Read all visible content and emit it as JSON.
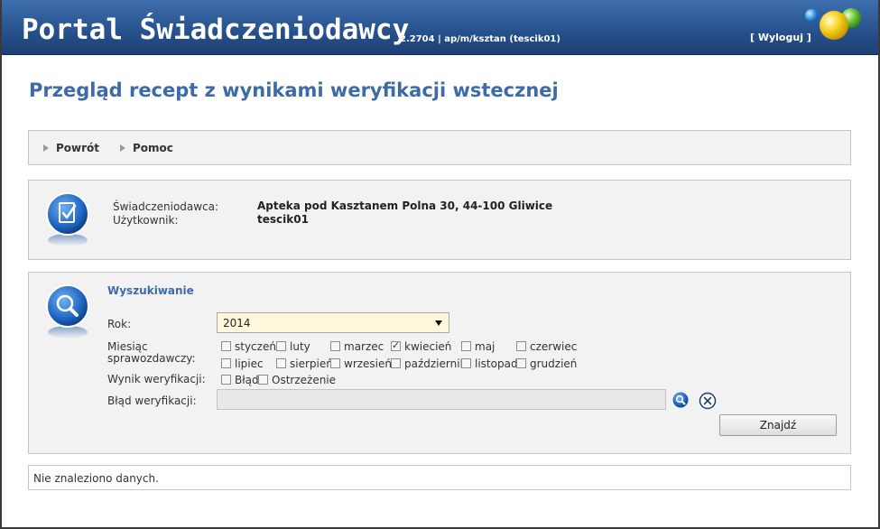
{
  "header": {
    "app_title": "Portal Świadczeniodawcy",
    "version": "2.2704 | ap/m/ksztan (tescik01)",
    "logout": "[ Wyloguj ]"
  },
  "page_title": "Przegląd recept z wynikami weryfikacji wstecznej",
  "nav": {
    "back": "Powrót",
    "help": "Pomoc"
  },
  "info": {
    "provider_label": "Świadczeniodawca:",
    "provider_value": "Apteka pod Kasztanem Polna 30, 44-100 Gliwice",
    "user_label": "Użytkownik:",
    "user_value": "tescik01"
  },
  "search": {
    "title": "Wyszukiwanie",
    "year_label": "Rok:",
    "year_value": "2014",
    "month_label_line1": "Miesiąc",
    "month_label_line2": "sprawozdawczy:",
    "months": [
      {
        "label": "styczeń",
        "checked": false
      },
      {
        "label": "luty",
        "checked": false
      },
      {
        "label": "marzec",
        "checked": false
      },
      {
        "label": "kwiecień",
        "checked": true
      },
      {
        "label": "maj",
        "checked": false
      },
      {
        "label": "czerwiec",
        "checked": false
      },
      {
        "label": "lipiec",
        "checked": false
      },
      {
        "label": "sierpień",
        "checked": false
      },
      {
        "label": "wrzesień",
        "checked": false
      },
      {
        "label": "październik",
        "checked": false
      },
      {
        "label": "listopad",
        "checked": false
      },
      {
        "label": "grudzień",
        "checked": false
      }
    ],
    "result_label": "Wynik weryfikacji:",
    "results": [
      {
        "label": "Błąd",
        "checked": false
      },
      {
        "label": "Ostrzeżenie",
        "checked": false
      }
    ],
    "error_label": "Błąd weryfikacji:",
    "error_value": "",
    "find_button": "Znajdź"
  },
  "result_message": "Nie znaleziono danych.",
  "colors": {
    "header_blue": "#2b5894",
    "title_blue": "#3d6ba8",
    "select_bg": "#fff7dc",
    "panel_bg": "#f2f2f2"
  },
  "icons": {
    "info": "clipboard-check-icon",
    "search": "magnifier-icon",
    "lookup": "search-icon",
    "clear": "clear-icon",
    "logo": "colored-balls-logo"
  }
}
